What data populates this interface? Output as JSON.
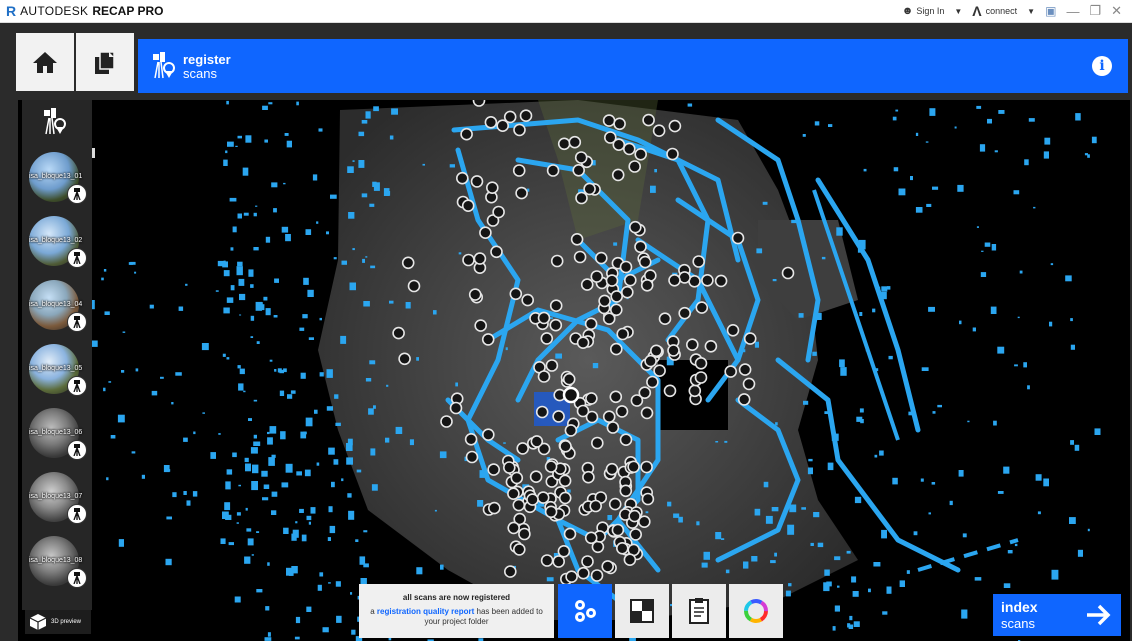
{
  "app": {
    "brand": "AUTODESK",
    "product": "RECAP PRO",
    "sign_in": "Sign In",
    "connect": "connect"
  },
  "header": {
    "title_bold": "register",
    "title_sub": "scans"
  },
  "scans": [
    {
      "label": "isa_bloque13_01"
    },
    {
      "label": "isa_bloque13_02"
    },
    {
      "label": "isa_bloque13_04"
    },
    {
      "label": "isa_bloque13_05"
    },
    {
      "label": "isa_bloque13_06"
    },
    {
      "label": "isa_bloque13_07"
    },
    {
      "label": "isa_bloque13_08"
    }
  ],
  "preview": {
    "label": "3D preview"
  },
  "status": {
    "title": "all scans are now registered",
    "line_prefix": "a",
    "link": "registration quality report",
    "line_suffix": "has been added to",
    "line2": "your project folder"
  },
  "next": {
    "label_bold": "index",
    "label_sub": "scans"
  },
  "colors": {
    "accent": "#0f66ff",
    "scan_points": "#2ba6f0"
  }
}
